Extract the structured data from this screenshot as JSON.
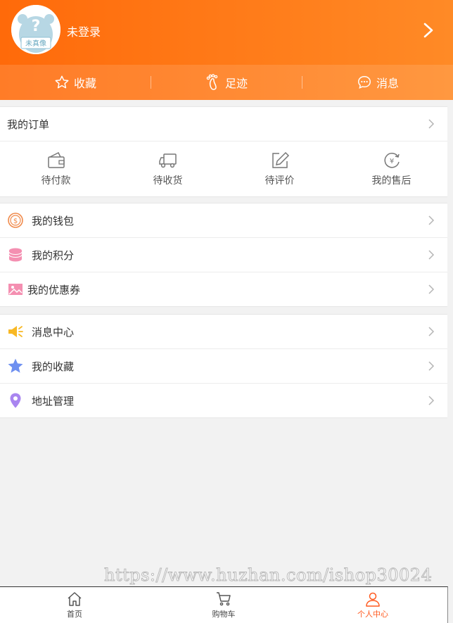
{
  "profile": {
    "avatar_text_top": "?",
    "avatar_text_bottom": "未真像",
    "login_label": "未登录"
  },
  "quick_bar": [
    {
      "label": "收藏",
      "icon": "star-outline-icon"
    },
    {
      "label": "足迹",
      "icon": "footprint-icon"
    },
    {
      "label": "消息",
      "icon": "chat-bubble-icon"
    }
  ],
  "orders": {
    "title": "我的订单",
    "items": [
      {
        "label": "待付款",
        "icon": "wallet-icon"
      },
      {
        "label": "待收货",
        "icon": "truck-icon"
      },
      {
        "label": "待评价",
        "icon": "edit-icon"
      },
      {
        "label": "我的售后",
        "icon": "refund-icon"
      }
    ]
  },
  "assets": {
    "items": [
      {
        "label": "我的钱包",
        "icon": "coin-icon"
      },
      {
        "label": "我的积分",
        "icon": "database-icon"
      },
      {
        "label": "我的优惠券",
        "icon": "image-icon"
      }
    ]
  },
  "services": {
    "items": [
      {
        "label": "消息中心",
        "icon": "megaphone-icon"
      },
      {
        "label": "我的收藏",
        "icon": "star-icon"
      },
      {
        "label": "地址管理",
        "icon": "location-pin-icon"
      }
    ]
  },
  "watermark": "https://www.huzhan.com/ishop30024",
  "tabbar": [
    {
      "label": "首页",
      "icon": "home-icon",
      "active": false
    },
    {
      "label": "购物车",
      "icon": "cart-icon",
      "active": false
    },
    {
      "label": "个人中心",
      "icon": "user-icon",
      "active": true
    }
  ],
  "colors": {
    "accent": "#ff6a0a",
    "active_tab": "#ff5a1f"
  }
}
